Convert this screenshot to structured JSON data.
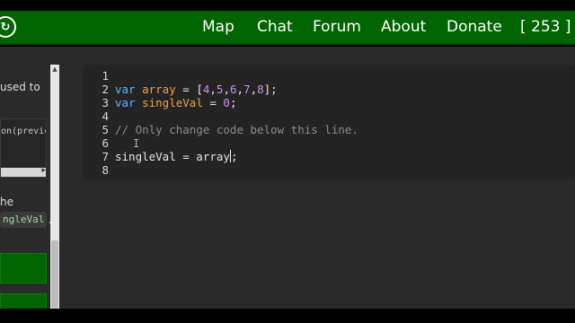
{
  "navbar": {
    "logo_glyph": "↻",
    "items": [
      {
        "label": "Map"
      },
      {
        "label": "Chat"
      },
      {
        "label": "Forum"
      },
      {
        "label": "About"
      },
      {
        "label": "Donate"
      },
      {
        "label": "[ 253 ]"
      }
    ]
  },
  "left_panel": {
    "text_partial_1": "used to",
    "code_partial": "on(previc",
    "text_partial_2": "he",
    "inline_code": "ngleVal",
    "after_inline": "."
  },
  "editor": {
    "line_numbers": [
      "1",
      "2",
      "3",
      "4",
      "5",
      "6",
      "7",
      "8"
    ],
    "line2": {
      "kw": "var",
      "name": "array",
      "eq": " = ",
      "open": "[",
      "n1": "4",
      "n2": "5",
      "n3": "6",
      "n4": "7",
      "n5": "8",
      "close": "]",
      "end": ";",
      "comma": ","
    },
    "line3": {
      "kw": "var",
      "name": "singleVal",
      "eq": " = ",
      "val": "0",
      "end": ";"
    },
    "line5": {
      "comment": "// Only change code below this line."
    },
    "line7": {
      "text": "singleVal = array",
      "end": ";"
    }
  },
  "colors": {
    "navbar": "#006400",
    "keyword": "#66b2ff",
    "variable": "#f0a14a",
    "number": "#c792ea",
    "comment": "#8a8a8a"
  }
}
